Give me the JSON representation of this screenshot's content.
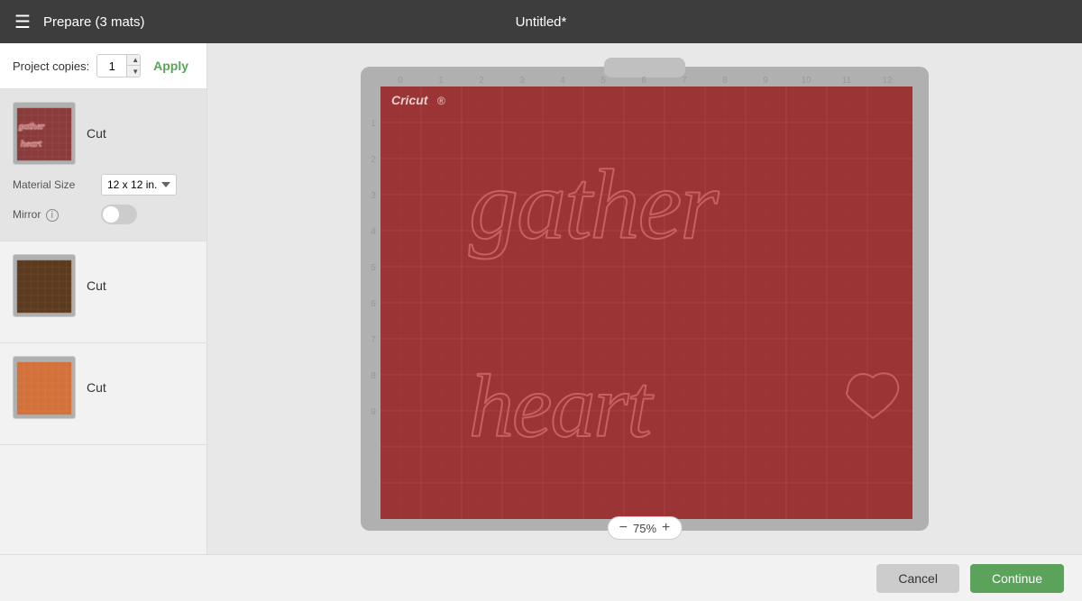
{
  "header": {
    "menu_icon": "☰",
    "title": "Prepare (3 mats)",
    "document_title": "Untitled*"
  },
  "sidebar": {
    "project_copies_label": "Project copies:",
    "copies_value": "1",
    "apply_label": "Apply",
    "mat1": {
      "cut_label": "Cut",
      "material_size_label": "Material Size",
      "material_size_value": "12 x 12 in.",
      "mirror_label": "Mirror",
      "color": "#8B3A3A"
    },
    "mat2": {
      "cut_label": "Cut",
      "color": "#5C3A1E"
    },
    "mat3": {
      "cut_label": "Cut",
      "color": "#E8783A"
    }
  },
  "canvas": {
    "zoom_percent": "75%",
    "zoom_minus": "−",
    "zoom_plus": "+"
  },
  "footer": {
    "cancel_label": "Cancel",
    "continue_label": "Continue"
  }
}
